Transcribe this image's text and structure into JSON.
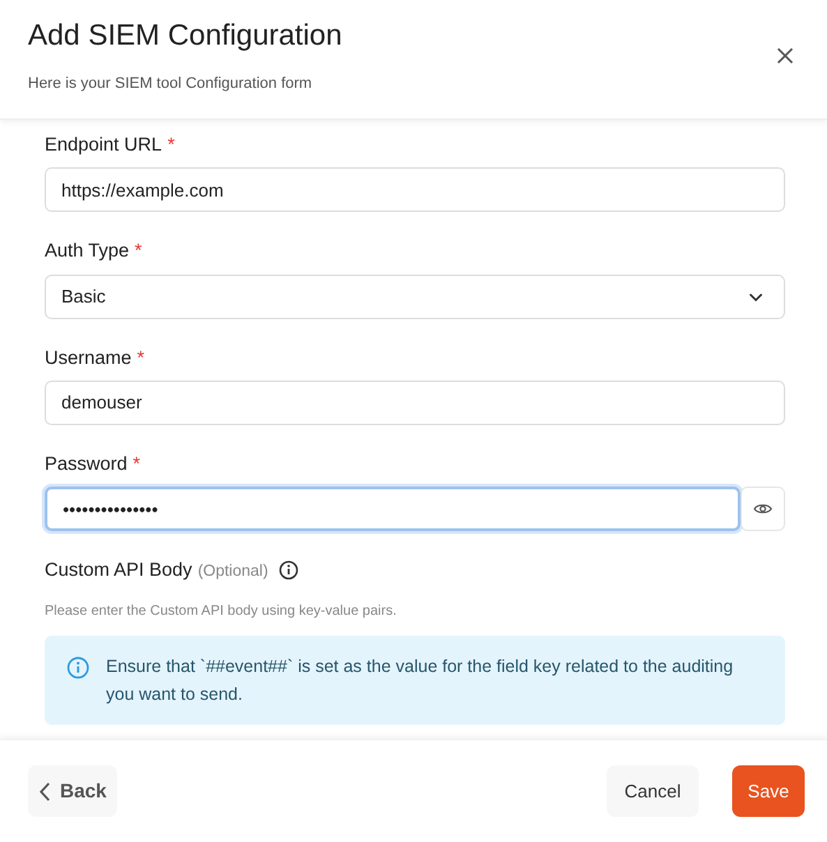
{
  "dialog": {
    "title": "Add SIEM Configuration",
    "subtitle": "Here is your SIEM tool Configuration form"
  },
  "fields": [
    {
      "kind": "text",
      "label": "Endpoint URL",
      "required_mark": "*",
      "value": "https://example.com",
      "focused": false
    },
    {
      "kind": "select",
      "label": "Auth Type",
      "required_mark": "*",
      "value": "Basic",
      "focused": false
    },
    {
      "kind": "text",
      "label": "Username",
      "required_mark": "*",
      "value": "demouser",
      "focused": false
    },
    {
      "kind": "password",
      "label": "Password",
      "required_mark": "*",
      "value": "•••••••••••••••",
      "focused": true
    }
  ],
  "custom_body": {
    "label": "Custom API Body",
    "optional": "(Optional)",
    "hint": "Please enter the Custom API body using key-value pairs.",
    "alert": "Ensure that `##event##` is set as the value for the field key related to the auditing you want to send."
  },
  "footer": {
    "back": "Back",
    "cancel": "Cancel",
    "save": "Save"
  }
}
